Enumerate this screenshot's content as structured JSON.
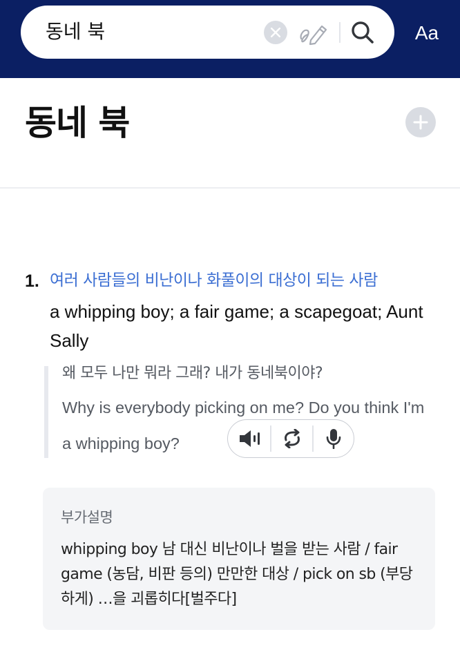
{
  "search": {
    "query": "동네 북"
  },
  "header": {
    "font_size_label": "Aa"
  },
  "entry": {
    "headword": "동네 북",
    "senses": [
      {
        "number": "1.",
        "definition_ko": "여러 사람들의 비난이나 화풀이의 대상이 되는 사람",
        "definition_en": "a whipping boy; a fair game; a scapegoat; Aunt Sally",
        "example": {
          "ko": "왜 모두 나만 뭐라 그래? 내가 동네북이야?",
          "en": "Why is everybody picking on me? Do you think I'm a whipping boy?"
        }
      }
    ],
    "note": {
      "title": "부가설명",
      "body": "whipping boy 남 대신 비난이나 벌을 받는 사람 / fair game (농담, 비판 등의) 만만한 대상 / pick on sb (부당하게) …을 괴롭히다[벌주다]"
    }
  },
  "colors": {
    "header_bg": "#0b1f63",
    "definition_ko": "#3c6fd3",
    "note_bg": "#f4f5f7"
  },
  "icons": [
    "clear-icon",
    "handwriting-icon",
    "search-icon",
    "add-icon",
    "speaker-icon",
    "repeat-icon",
    "microphone-icon"
  ]
}
